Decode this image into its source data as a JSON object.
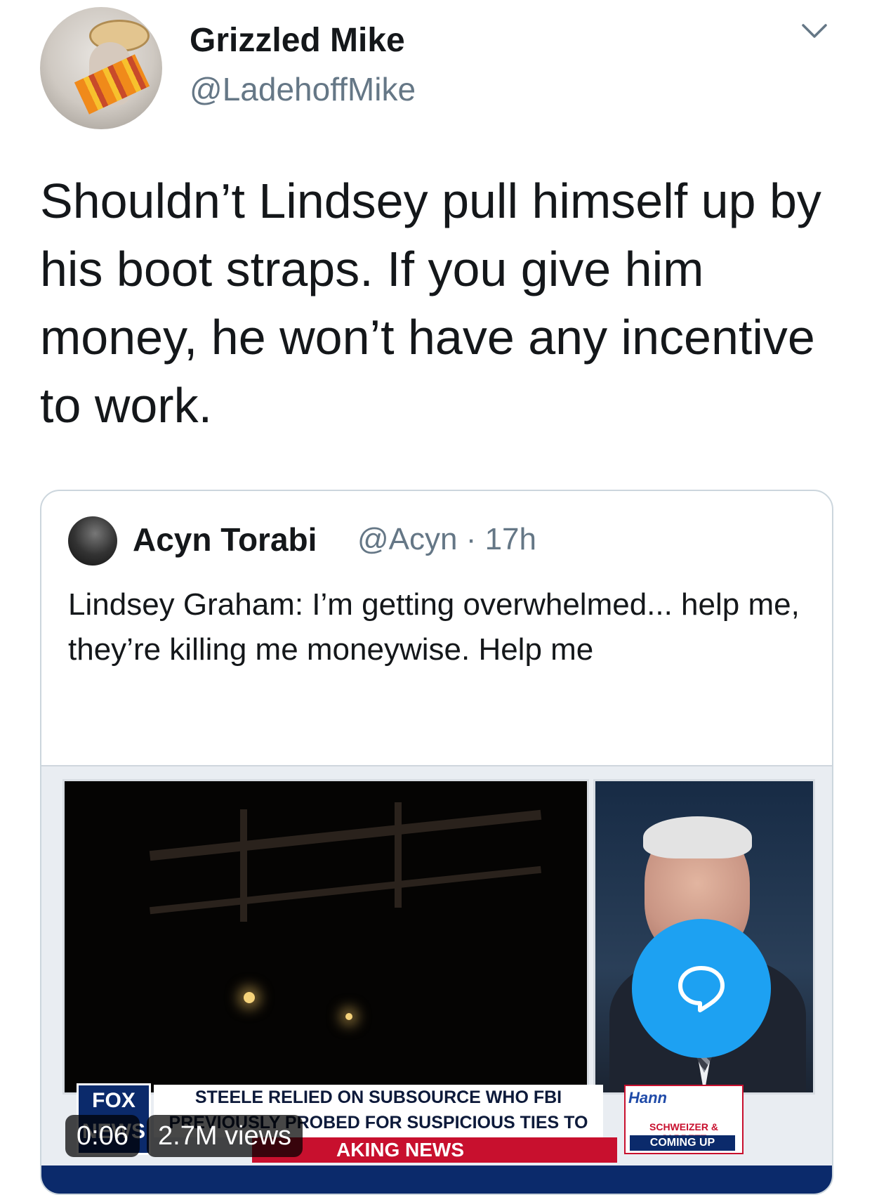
{
  "author": {
    "name": "Grizzled Mike",
    "handle": "@LadehoffMike"
  },
  "tweet": {
    "text": "Shouldn’t Lindsey pull himself up by his boot straps. If you give him money, he won’t have any incentive to work."
  },
  "quoted_tweet": {
    "name": "Acyn Torabi",
    "handle_and_time": "@Acyn · 17h",
    "text": "Lindsey Graham: I’m getting overwhelmed... help me, they’re killing me moneywise. Help me"
  },
  "video": {
    "chyron": "STEELE RELIED ON SUBSOURCE WHO FBI PREVIOUSLY PROBED FOR SUSPICIOUS TIES TO RUSSIA, NEW DOCS SHOWS",
    "banner": "AKING NEWS",
    "fox_logo": "FOX NEWS",
    "show_name": "Hann",
    "show_hosts": "SCHWEIZER & JARRETT",
    "coming_up": "COMING UP",
    "time": "0:06",
    "views": "2.7M views"
  },
  "icons": {
    "menu": "chevron-down-icon",
    "fab": "chat-bubble-icon"
  },
  "colors": {
    "accent": "#1da1f2",
    "secondary_text": "#657786",
    "border": "#ccd6dd"
  }
}
